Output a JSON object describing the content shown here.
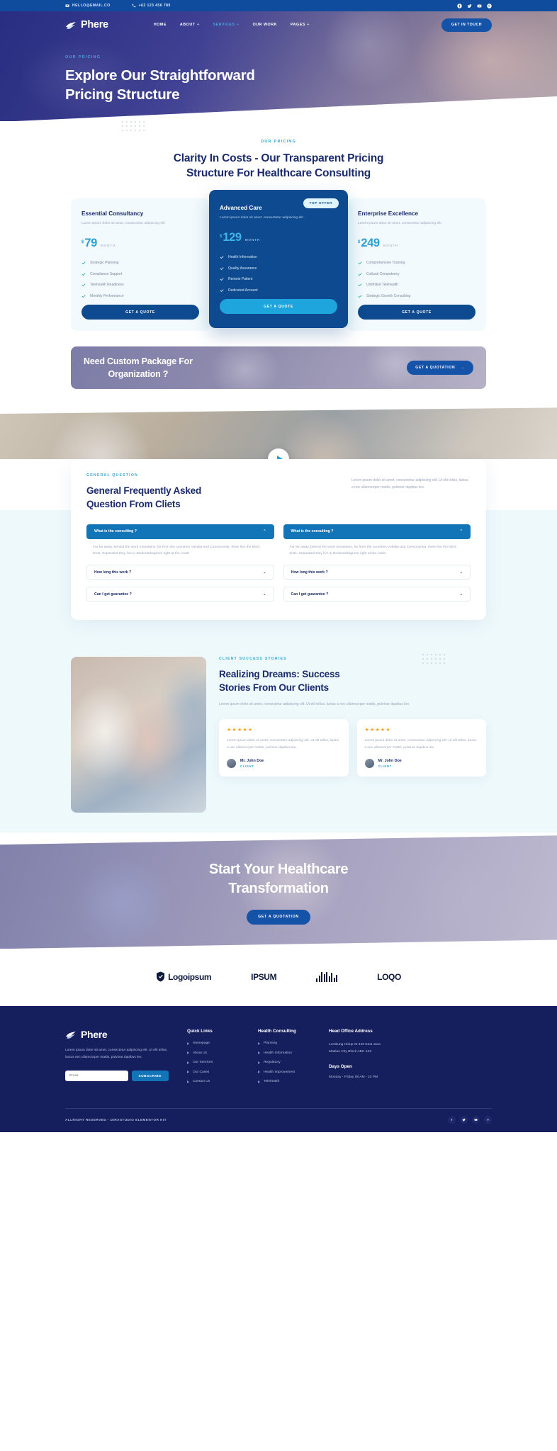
{
  "topbar": {
    "email": "HELLO@EMAIL.CO",
    "phone": "+62 123 456 789",
    "social": [
      "facebook-icon",
      "twitter-icon",
      "youtube-icon",
      "pinterest-icon"
    ]
  },
  "nav": {
    "brand": "Phere",
    "items": [
      {
        "label": "HOME",
        "has_caret": false,
        "active": false
      },
      {
        "label": "ABOUT",
        "has_caret": true,
        "active": false
      },
      {
        "label": "SERVICES",
        "has_caret": true,
        "active": true
      },
      {
        "label": "OUR WORK",
        "has_caret": false,
        "active": false
      },
      {
        "label": "PAGES",
        "has_caret": true,
        "active": false
      }
    ],
    "cta": "GET IN TOUCH"
  },
  "hero": {
    "eyebrow": "OUR PRICING",
    "title_line1": "Explore Our Straightforward",
    "title_line2": "Pricing Structure"
  },
  "pricing": {
    "eyebrow": "OUR PRICING",
    "title_line1": "Clarity In Costs - Our Transparent Pricing",
    "title_line2": "Structure For Healthcare Consulting",
    "plans": [
      {
        "name": "Essential Consultancy",
        "desc": "Lorem ipsum dolor sit amet, consectetur adipiscing elit",
        "currency": "$",
        "amount": "79",
        "period": "MONTH",
        "features": [
          "Strategic Planning",
          "Compliance Support",
          "Telehealth Readiness",
          "Monthly Performance"
        ],
        "cta": "GET A QUOTE",
        "badge": null,
        "featured": false
      },
      {
        "name": "Advanced Care",
        "desc": "Lorem ipsum dolor sit amet, consectetur adipiscing elit",
        "currency": "$",
        "amount": "129",
        "period": "MONTH",
        "features": [
          "Health Information",
          "Quality Assurance",
          "Remote Patient",
          "Dedicated Account"
        ],
        "cta": "GET A QUOTE",
        "badge": "TOP OFFER",
        "featured": true
      },
      {
        "name": "Enterprise Excellence",
        "desc": "Lorem ipsum dolor sit amet, consectetur adipiscing elit",
        "currency": "$",
        "amount": "249",
        "period": "MONTH",
        "features": [
          "Comprehensive Training",
          "Cultural Competency",
          "Unlimited Telehealth",
          "Strategic Growth Consulting"
        ],
        "cta": "GET A QUOTE",
        "badge": null,
        "featured": false
      }
    ]
  },
  "custom_banner": {
    "title_line1": "Need Custom Package For",
    "title_line2": "Organization ?",
    "cta": "GET A QUOTATION",
    "cta_arrow": "→"
  },
  "video": {
    "play_label": "play-video"
  },
  "faq": {
    "eyebrow": "GENERAL QUESTION",
    "title_line1": "General Frequently Asked",
    "title_line2": "Question From Cliets",
    "desc": "Lorem ipsum dolor sit amet, consectetur adipiscing elit. Ut elit tellus, luctus a nec ullamcorper mattis, pulvinar dapibus leo.",
    "items": [
      {
        "q": "What is the consulting ?",
        "open": true,
        "a": "Far far away, behind the word mountains, far from the countries Vokalia and Consonantia, there live the blind texts. Separated they live in Bookmarksgrove right at the coast"
      },
      {
        "q": "What is the consulting ?",
        "open": true,
        "a": "Far far away, behind the word mountains, far from the countries Vokalia and Consonantia, there live the blind texts. Separated they live in Bookmarksgrove right at the coast"
      },
      {
        "q": "How long this work ?",
        "open": false,
        "a": ""
      },
      {
        "q": "How long this work ?",
        "open": false,
        "a": ""
      },
      {
        "q": "Can I get guarantee ?",
        "open": false,
        "a": ""
      },
      {
        "q": "Can I get guarantee ?",
        "open": false,
        "a": ""
      }
    ]
  },
  "testimonials": {
    "eyebrow": "CLIENT SUCCESS STORIES",
    "title_line1": "Realizing Dreams: Success",
    "title_line2": "Stories From Our Clients",
    "desc": "Lorem ipsum dolor sit amet, consectetur adipiscing elit. Ut elit tellus, luctus a nec ullamcorper mattis, pulvinar dapibus leo.",
    "cards": [
      {
        "stars": "★★★★★",
        "text": "Lorem ipsum dolor sit amet, consectetur adipiscing elit. Ut elit tellus, luctus a nec ullamcorper mattis, pulvinar dapibus leo.",
        "name": "Mr. John Doe",
        "role": "CLIENT"
      },
      {
        "stars": "★★★★★",
        "text": "Lorem ipsum dolor sit amet, consectetur adipiscing elit. Ut elit tellus, luctus a nec ullamcorper mattis, pulvinar dapibus leo.",
        "name": "Mr. John Doe",
        "role": "CLIENT"
      }
    ]
  },
  "cta": {
    "title_line1": "Start Your Healthcare",
    "title_line2": "Transformation",
    "button": "GET A QUOTATION"
  },
  "logos": [
    {
      "name": "Logoipsum",
      "kind": "shield"
    },
    {
      "name": "IPSUM",
      "kind": "text"
    },
    {
      "name": "bars",
      "kind": "bars"
    },
    {
      "name": "LOQO",
      "kind": "text"
    }
  ],
  "footer": {
    "brand": "Phere",
    "about": "Lorem ipsum dolor sit amet, consectetur adipiscing elit. Ut elit tellus, luctus nec ullamcorper mattis, pulvinar dapibus leo.",
    "email_placeholder": "Email",
    "subscribe": "SUBSCRIBE",
    "quick_links_title": "Quick Links",
    "quick_links": [
      "Homepage",
      "About Us",
      "Our Services",
      "Our Cases",
      "Contact Us"
    ],
    "health_title": "Health Consulting",
    "health_links": [
      "Planning",
      "Health Information",
      "Regulatory",
      "Health Improvement",
      "Telehealth"
    ],
    "office_title": "Head Office Address",
    "office_line1": "Lumbung Hidup St 429 East Java",
    "office_line2": "Madiun City Block ABC 123",
    "days_title": "Days Open",
    "days_value": "Monday - Friday 08 AM - 10 PM",
    "copyright": "ALLRIGHT RESERVED - DIRASTUDIO ELEMENTOR KIT",
    "social": [
      "facebook-icon",
      "twitter-icon",
      "youtube-icon",
      "pinterest-icon"
    ]
  }
}
